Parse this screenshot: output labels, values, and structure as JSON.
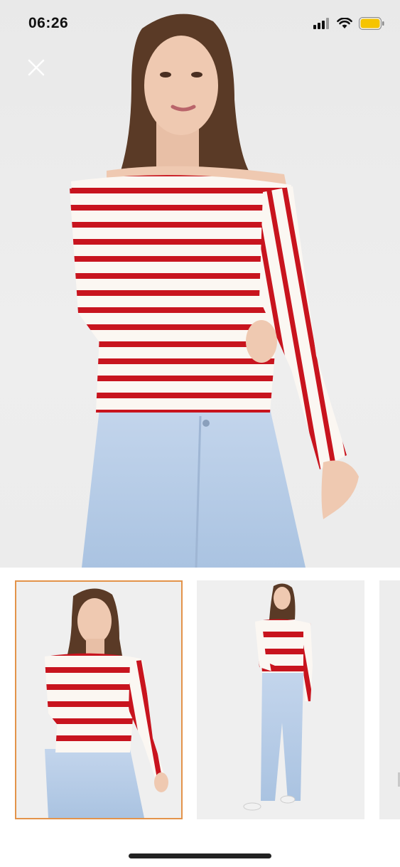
{
  "status_bar": {
    "time": "06:26",
    "signal_icon": "cellular-signal-icon",
    "wifi_icon": "wifi-icon",
    "battery_icon": "battery-icon",
    "battery_color": "#f5c400"
  },
  "viewer": {
    "close_icon": "close-icon",
    "main_image": "main-product-photo",
    "thumbnails": [
      {
        "name": "thumbnail-1",
        "selected": true
      },
      {
        "name": "thumbnail-2",
        "selected": false
      },
      {
        "name": "thumbnail-3",
        "selected": false
      }
    ],
    "selected_border_color": "#e3934a"
  },
  "colors": {
    "stripe_red": "#c8141e",
    "jeans_blue": "#b9cde6",
    "background": "#ececec"
  }
}
